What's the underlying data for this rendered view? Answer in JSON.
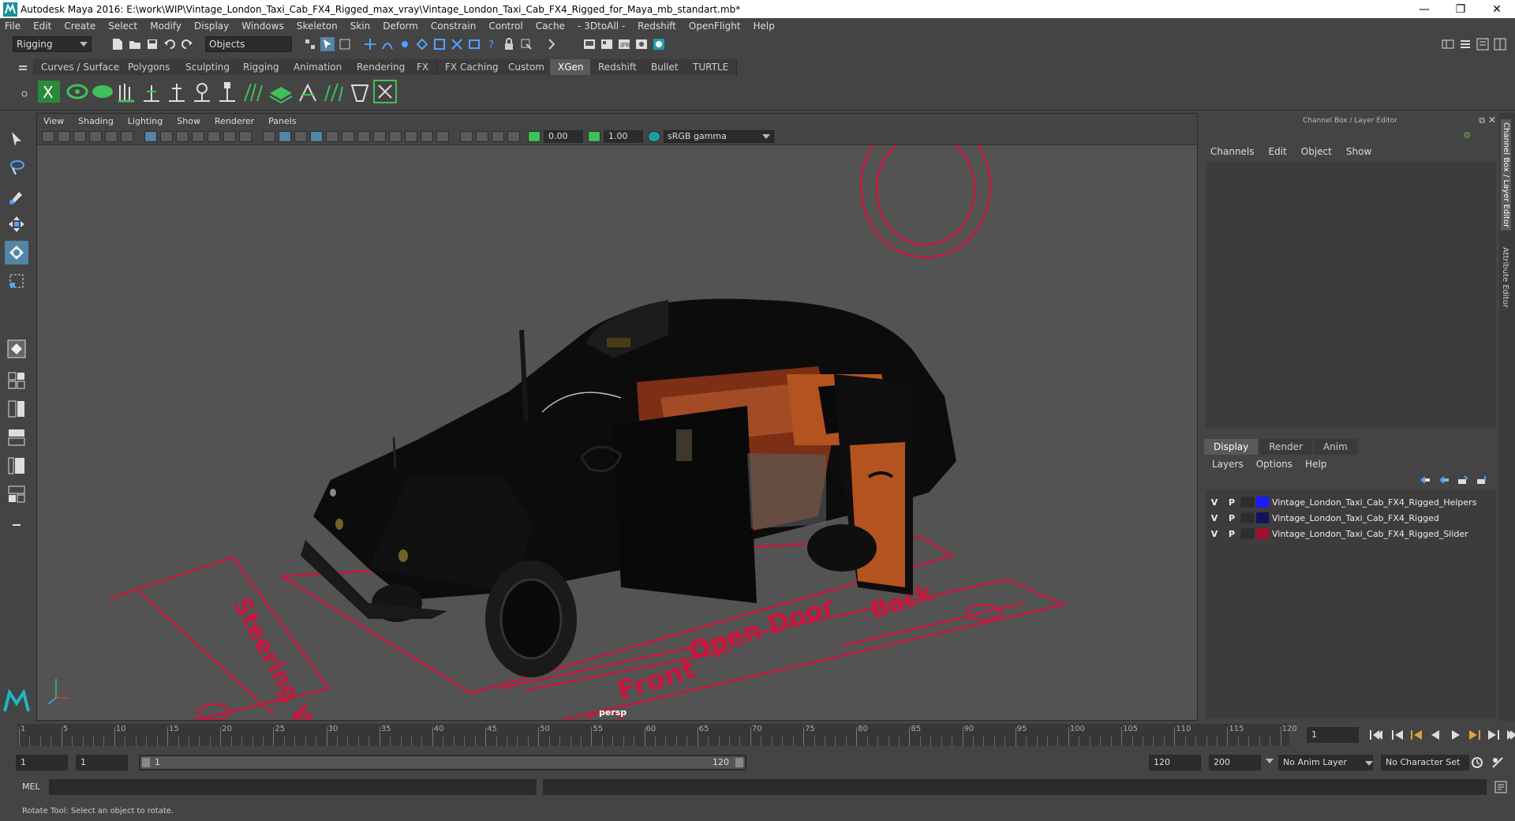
{
  "window": {
    "title": "Autodesk Maya 2016: E:\\work\\WIP\\Vintage_London_Taxi_Cab_FX4_Rigged_max_vray\\Vintage_London_Taxi_Cab_FX4_Rigged_for_Maya_mb_standart.mb*",
    "minimize": "—",
    "restore": "❐",
    "close": "✕"
  },
  "menubar": [
    "File",
    "Edit",
    "Create",
    "Select",
    "Modify",
    "Display",
    "Windows",
    "Skeleton",
    "Skin",
    "Deform",
    "Constrain",
    "Control",
    "Cache",
    "- 3DtoAll -",
    "Redshift",
    "OpenFlight",
    "Help"
  ],
  "statusline": {
    "mode": "Rigging",
    "objects_label": "Objects"
  },
  "shelf_tabs": [
    "Curves / Surfaces",
    "Polygons",
    "Sculpting",
    "Rigging",
    "Animation",
    "Rendering",
    "FX",
    "FX Caching",
    "Custom",
    "XGen",
    "Redshift",
    "Bullet",
    "TURTLE"
  ],
  "shelf_active": "XGen",
  "viewport": {
    "menu": [
      "View",
      "Shading",
      "Lighting",
      "Show",
      "Renderer",
      "Panels"
    ],
    "exposure": "0.00",
    "gamma": "1.00",
    "colorspace": "sRGB gamma",
    "camera": "persp",
    "scene_labels": {
      "steering": "Steering Wheel",
      "front": "Front",
      "open_door": "Open Door",
      "back": "Back"
    },
    "accent": "#c8163c"
  },
  "channel_box": {
    "header": "Channel Box / Layer Editor",
    "menu": [
      "Channels",
      "Edit",
      "Object",
      "Show"
    ]
  },
  "layer_editor": {
    "tabs": [
      "Display",
      "Render",
      "Anim"
    ],
    "menu": [
      "Layers",
      "Options",
      "Help"
    ],
    "layers": [
      {
        "v": "V",
        "p": "P",
        "name": "Vintage_London_Taxi_Cab_FX4_Rigged_Helpers",
        "color": "#1a1aff"
      },
      {
        "v": "V",
        "p": "P",
        "name": "Vintage_London_Taxi_Cab_FX4_Rigged",
        "color": "#14145a"
      },
      {
        "v": "V",
        "p": "P",
        "name": "Vintage_London_Taxi_Cab_FX4_Rigged_Slider",
        "color": "#a0102c"
      }
    ]
  },
  "side_tabs": [
    "Channel Box / Layer Editor",
    "Attribute Editor"
  ],
  "timeline": {
    "labels": [
      "1",
      "5",
      "10",
      "15",
      "20",
      "25",
      "30",
      "35",
      "40",
      "45",
      "50",
      "55",
      "60",
      "65",
      "70",
      "75",
      "80",
      "85",
      "90",
      "95",
      "100",
      "105",
      "110",
      "115",
      "120"
    ],
    "current_frame": "1"
  },
  "range": {
    "start": "1",
    "playback_start": "1",
    "slider_start": "1",
    "slider_end": "120",
    "playback_end": "120",
    "end": "200",
    "anim_layer": "No Anim Layer",
    "char_set": "No Character Set"
  },
  "cmdline": {
    "label": "MEL"
  },
  "help": {
    "text": "Rotate Tool: Select an object to rotate."
  }
}
